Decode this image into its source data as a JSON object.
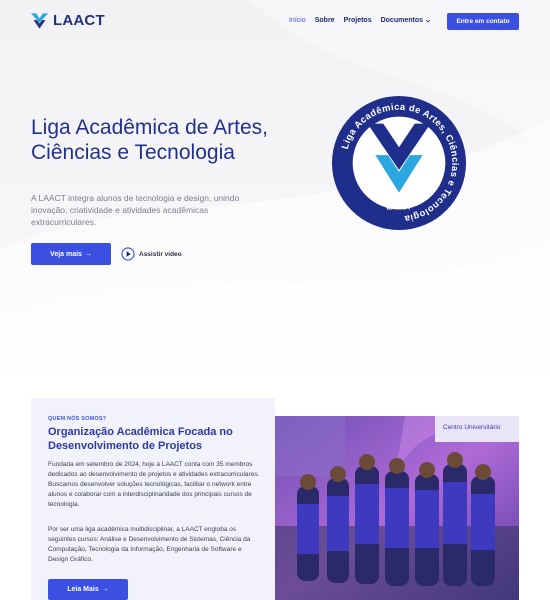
{
  "brand": {
    "name": "LAACT"
  },
  "nav": {
    "items": [
      "Início",
      "Sobre",
      "Projetos",
      "Documentos"
    ],
    "cta": "Entre em contato"
  },
  "hero": {
    "title": "Liga Acadêmica de Artes, Ciências e Tecnologia",
    "description": "A LAACT integra alunos de tecnologia e design, unindo inovação, criatividade e atividades acadêmicas extracurriculares.",
    "primary_button": "Veja mais",
    "secondary_button": "Assistir vídeo",
    "seal_text": "Liga Acadêmica de Artes, Ciências e Tecnologia",
    "seal_label": "LAACT"
  },
  "about": {
    "kicker": "QUEM NÓS SOMOS?",
    "title": "Organização Acadêmica Focada no Desenvolvimento de Projetos",
    "paragraph1": "Fundada em setembro de 2024, hoje a LAACT conta com 35 membros dedicados ao desenvolvimento de projetos e atividades extracurriculares. Buscamos desenvolver soluções tecnológicas, facilitar o network entre alunos e colaborar com a interdisciplinaridade dos principais cursos de tecnologia.",
    "paragraph2": "Por ser uma liga acadêmica multidisciplinar, a LAACT engloba os seguintes cursos: Análise e Desenvolvimento de Sistemas, Ciência da Computação, Tecnologia da Informação, Engenharia de Software e Design Gráfico.",
    "button": "Leia Mais",
    "photo_sign_text": "Centro Universitário"
  },
  "colors": {
    "primary": "#3b4fe0",
    "navy": "#22318a",
    "seal_ring": "#1f2e8a",
    "sky": "#2aa6e0"
  },
  "icons": {
    "logo": "laact-chevron-logo",
    "play": "play-icon",
    "arrow": "arrow-right-icon",
    "dropdown": "chevron-down-icon"
  }
}
